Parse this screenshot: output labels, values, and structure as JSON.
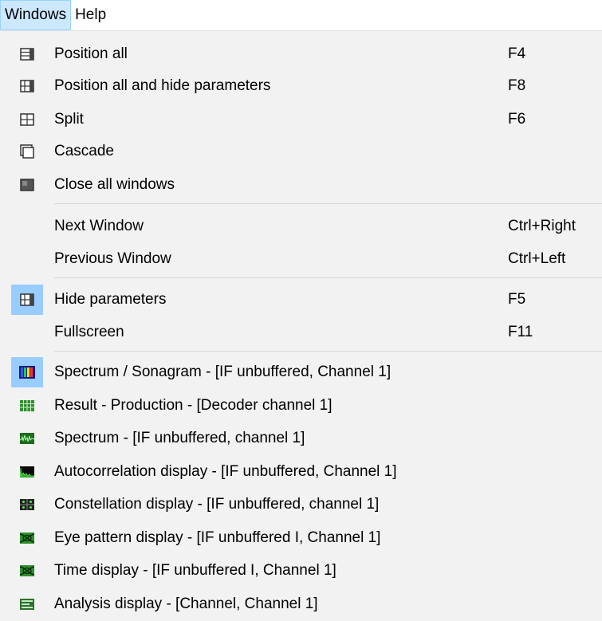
{
  "menubar": {
    "windows": "Windows",
    "help": "Help"
  },
  "menu": {
    "items": [
      {
        "label": "Position all",
        "shortcut": "F4",
        "icon": "position-all-icon"
      },
      {
        "label": "Position all and hide parameters",
        "shortcut": "F8",
        "icon": "position-hide-icon"
      },
      {
        "label": "Split",
        "shortcut": "F6",
        "icon": "split-icon"
      },
      {
        "label": "Cascade",
        "shortcut": "",
        "icon": "cascade-icon"
      },
      {
        "label": "Close all windows",
        "shortcut": "",
        "icon": "close-all-icon"
      },
      {
        "label": "Next Window",
        "shortcut": "Ctrl+Right"
      },
      {
        "label": "Previous Window",
        "shortcut": "Ctrl+Left"
      },
      {
        "label": "Hide parameters",
        "shortcut": "F5",
        "icon": "hide-parameters-icon",
        "checked": true
      },
      {
        "label": "Fullscreen",
        "shortcut": "F11"
      },
      {
        "label": "Spectrum / Sonagram - [IF unbuffered, Channel 1]",
        "icon": "sonagram-icon",
        "checked": true
      },
      {
        "label": "Result - Production - [Decoder channel 1]",
        "icon": "result-table-icon"
      },
      {
        "label": "Spectrum - [IF unbuffered, channel 1]",
        "icon": "spectrum-icon"
      },
      {
        "label": "Autocorrelation display - [IF unbuffered, Channel 1]",
        "icon": "autocorrelation-icon"
      },
      {
        "label": "Constellation display - [IF unbuffered, channel 1]",
        "icon": "constellation-icon"
      },
      {
        "label": "Eye pattern display - [IF unbuffered I, Channel 1]",
        "icon": "eye-pattern-icon"
      },
      {
        "label": "Time display - [IF unbuffered I, Channel 1]",
        "icon": "time-display-icon"
      },
      {
        "label": "Analysis display - [Channel, Channel 1]",
        "icon": "analysis-display-icon"
      }
    ]
  },
  "colors": {
    "menu_background": "#f2f2f2",
    "highlight": "#99ccff",
    "menubar_active": "#cce8ff",
    "icon_green": "#2f8f2f"
  }
}
